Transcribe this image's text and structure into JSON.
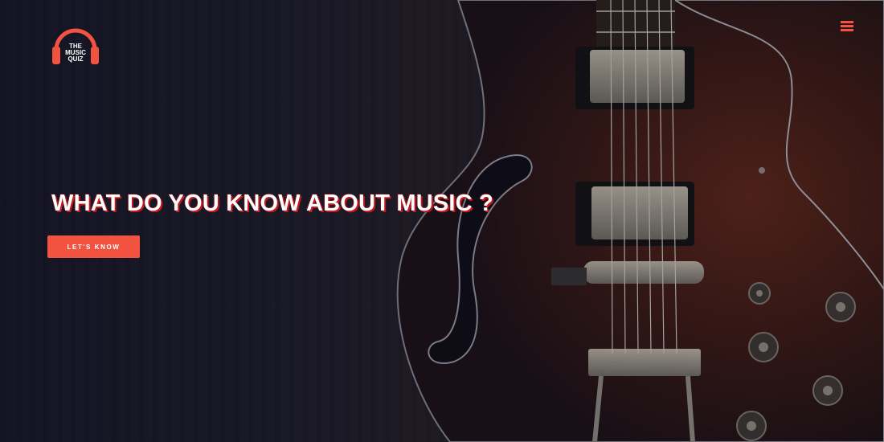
{
  "brand": {
    "logo_line1": "THE",
    "logo_line2": "MUSIC",
    "logo_line3": "QUIZ",
    "accent_color": "#f25341"
  },
  "nav": {
    "menu_icon": "hamburger-menu-icon"
  },
  "hero": {
    "headline": "WHAT DO YOU KNOW ABOUT MUSIC ?",
    "cta_label": "LET'S KNOW",
    "background_image": "electric guitar on dark wood"
  }
}
